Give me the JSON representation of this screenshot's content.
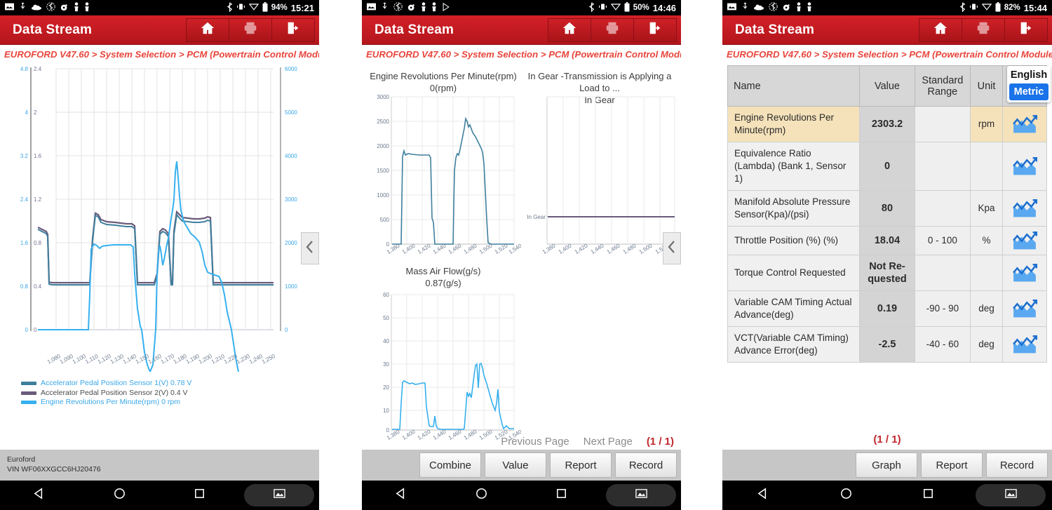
{
  "app": {
    "title": "Data Stream",
    "breadcrumb": "EUROFORD V47.60 > System Selection > PCM (Powertrain Control Module)"
  },
  "status_bars": [
    {
      "battery": "94%",
      "time": "15:21"
    },
    {
      "battery": "50%",
      "time": "14:46"
    },
    {
      "battery": "82%",
      "time": "15:44"
    }
  ],
  "titlebar_icons": [
    "home-icon",
    "print-icon",
    "exit-icon"
  ],
  "panel1": {
    "vehicle": "Euroford",
    "vin": "VIN WF06XXGCC6HJ20476",
    "legend": [
      {
        "label": "Accelerator Pedal Position Sensor 1(V) 0.78 V",
        "color": "#3f7f9e",
        "text_color": "#3aa7e8"
      },
      {
        "label": "Accelerator Pedal Position Sensor 2(V) 0.4 V",
        "color": "#6a5b7b",
        "text_color": "#4a4a4a"
      },
      {
        "label": "Engine Revolutions Per Minute(rpm) 0 rpm",
        "color": "#36b0ef",
        "text_color": "#3aa7e8"
      }
    ],
    "collapse_icon": "chevron-left-icon"
  },
  "panel2": {
    "charts": [
      {
        "title": "Engine Revolutions Per Minute(rpm)",
        "subtitle": "0(rpm)"
      },
      {
        "title": "In Gear -Transmission is Applying a Load to ...",
        "subtitle": "In Gear"
      },
      {
        "title": "Mass Air Flow(g/s)",
        "subtitle": "0.87(g/s)"
      }
    ],
    "pager": {
      "previous": "Previous Page",
      "next": "Next Page",
      "count": "(1 / 1)"
    },
    "buttons": [
      "Combine",
      "Value",
      "Report",
      "Record"
    ],
    "collapse_icon": "chevron-left-icon"
  },
  "panel3": {
    "columns": [
      "Name",
      "Value",
      "Standard Range",
      "Unit"
    ],
    "unit_toggle": {
      "english": "English",
      "metric": "Metric",
      "selected": "Metric",
      "accent": "#1a73e8"
    },
    "rows": [
      {
        "name": "Engine Revolutions Per Minute(rpm)",
        "value": "2303.2",
        "range": "",
        "unit": "rpm",
        "highlight": true,
        "graph_icon": "line-chart-icon"
      },
      {
        "name": "Equivalence Ratio (Lambda) (Bank 1, Sensor 1)",
        "value": "0",
        "range": "",
        "unit": "",
        "highlight": false,
        "graph_icon": "line-chart-icon"
      },
      {
        "name": "Manifold Absolute Pressure Sensor(Kpa)/(psi)",
        "value": "80",
        "range": "",
        "unit": "Kpa",
        "highlight": false,
        "graph_icon": "line-chart-icon"
      },
      {
        "name": "Throttle Position (%) (%)",
        "value": "18.04",
        "range": "0 - 100",
        "unit": "%",
        "highlight": false,
        "graph_icon": "line-chart-icon"
      },
      {
        "name": "Torque Control Requested",
        "value": "Not Re-quested",
        "range": "",
        "unit": "",
        "highlight": false,
        "graph_icon": "line-chart-icon"
      },
      {
        "name": "Variable CAM Timing Actual Advance(deg)",
        "value": "0.19",
        "range": "-90 - 90",
        "unit": "deg",
        "highlight": false,
        "graph_icon": "line-chart-icon"
      },
      {
        "name": "VCT(Variable CAM Timing) Advance Error(deg)",
        "value": "-2.5",
        "range": "-40 - 60",
        "unit": "deg",
        "highlight": false,
        "graph_icon": "line-chart-icon"
      }
    ],
    "page_indicator": "(1 / 1)",
    "buttons": [
      "Graph",
      "Report",
      "Record"
    ]
  },
  "chart_data": [
    {
      "type": "line",
      "id": "panel1-combined",
      "title": "",
      "xlabel": "",
      "grid": true,
      "legend": "bottom",
      "x_ticks": [
        "1,080",
        "1,090",
        "1,100",
        "1,110",
        "1,120",
        "1,130",
        "1,140",
        "1,150",
        "1,160",
        "1,170",
        "1,180",
        "1,190",
        "1,200",
        "1,210",
        "1,220",
        "1,230",
        "1,240",
        "1,250"
      ],
      "axes": [
        {
          "name": "Accelerator Pedal Position Sensor 1(V)",
          "ticks": [
            "0",
            "0.8",
            "1.6",
            "2.4",
            "3.2",
            "4",
            "4.8"
          ],
          "ylim": [
            0,
            4.8
          ],
          "side": "left",
          "color": "#3aa7e8"
        },
        {
          "name": "Accelerator Pedal Position Sensor 2(V)",
          "ticks": [
            "0",
            "0.4",
            "0.8",
            "1.2",
            "1.6",
            "2",
            "2.4"
          ],
          "ylim": [
            0,
            2.4
          ],
          "side": "left",
          "color": "#7a6f95"
        },
        {
          "name": "Engine Revolutions Per Minute(rpm)",
          "ticks": [
            "0",
            "1000",
            "2000",
            "3000",
            "4000",
            "5000",
            "6000"
          ],
          "ylim": [
            0,
            6000
          ],
          "side": "right",
          "color": "#3aa7e8"
        }
      ],
      "series": [
        {
          "name": "Accelerator Pedal Position Sensor 1(V)",
          "color": "#3f7f9e",
          "current": "0.78 V",
          "values": [
            1.92,
            1.9,
            1.88,
            0.88,
            0.88,
            0.88,
            0.88,
            0.88,
            0.88,
            2.62,
            2.4,
            2.38,
            2.36,
            2.34,
            2.34,
            2.32,
            0.88,
            0.88,
            0.88,
            1.88,
            1.92,
            0.88,
            2.52,
            2.4,
            2.38,
            2.36,
            2.38,
            2.4,
            0.88,
            0.88,
            0.88,
            0.88,
            0.88,
            0.88,
            0.88,
            0.88,
            0.88,
            0.88,
            0.88,
            0.88,
            0.88,
            0.88,
            0.88
          ]
        },
        {
          "name": "Accelerator Pedal Position Sensor 2(V)",
          "color": "#6a5b7b",
          "current": "0.4 V",
          "values": [
            1.94,
            1.92,
            1.9,
            0.88,
            0.88,
            0.88,
            0.88,
            0.88,
            0.88,
            2.64,
            2.44,
            2.42,
            2.4,
            2.38,
            2.38,
            2.36,
            0.88,
            0.88,
            0.88,
            1.92,
            1.96,
            0.88,
            2.54,
            2.46,
            2.44,
            2.42,
            2.44,
            2.46,
            0.88,
            0.88,
            0.88,
            0.88,
            0.88,
            0.88,
            0.88,
            0.88,
            0.88,
            0.88,
            0.88,
            0.88,
            0.88,
            0.88,
            0.88
          ]
        },
        {
          "name": "Engine Revolutions Per Minute(rpm)",
          "color": "#36b0ef",
          "current": "0 rpm",
          "values": [
            0,
            0,
            0,
            0,
            0,
            0,
            0,
            0,
            900,
            1780,
            1820,
            1830,
            1830,
            1830,
            1830,
            1400,
            700,
            180,
            0,
            1000,
            1850,
            1500,
            1790,
            2400,
            3100,
            2600,
            2350,
            2300,
            2080,
            1180,
            1100,
            1050,
            960,
            500,
            100,
            0,
            0,
            0,
            0,
            0,
            0,
            0,
            0
          ]
        }
      ]
    },
    {
      "type": "line",
      "id": "panel2-rpm",
      "title": "Engine Revolutions Per Minute(rpm)",
      "subtitle": "0(rpm)",
      "ylim": [
        0,
        3000
      ],
      "y_ticks": [
        "0",
        "500",
        "1000",
        "1500",
        "2000",
        "2500",
        "3000"
      ],
      "x_ticks": [
        "1,380",
        "1,400",
        "1,420",
        "1,440",
        "1,460",
        "1,480",
        "1,500",
        "1,520",
        "1,540"
      ],
      "color": "#3f7f9e",
      "values": [
        0,
        0,
        0,
        0,
        1850,
        1800,
        1790,
        1790,
        1780,
        1780,
        1770,
        1760,
        600,
        520,
        0,
        0,
        0,
        0,
        1900,
        2050,
        2300,
        2530,
        2450,
        2350,
        2150,
        1990,
        700,
        480,
        0,
        0,
        0,
        0
      ]
    },
    {
      "type": "line",
      "id": "panel2-ingear",
      "title": "In Gear -Transmission is Applying a Load to ...",
      "subtitle": "In Gear",
      "y_ticks": [
        "In Gear"
      ],
      "x_ticks": [
        "1,380",
        "1,400",
        "1,420",
        "1,440",
        "1,460",
        "1,480",
        "1,500",
        "1,520",
        "1,540"
      ],
      "color": "#6a5b7b",
      "values": [
        1,
        1,
        1,
        1,
        1,
        1,
        1,
        1,
        1,
        1,
        1,
        1,
        1,
        1,
        1,
        1
      ]
    },
    {
      "type": "line",
      "id": "panel2-maf",
      "title": "Mass Air Flow(g/s)",
      "subtitle": "0.87(g/s)",
      "ylim": [
        0,
        60
      ],
      "y_ticks": [
        "0",
        "10",
        "20",
        "30",
        "40",
        "50",
        "60"
      ],
      "x_ticks": [
        "1,380",
        "1,400",
        "1,420",
        "1,440",
        "1,460",
        "1,480",
        "1,500",
        "1,520",
        "1,540"
      ],
      "color": "#36b0ef",
      "values": [
        0,
        0,
        0,
        0,
        21,
        20,
        19.5,
        19.4,
        19.5,
        19.3,
        19.4,
        1,
        1,
        6.3,
        0.5,
        0.4,
        0.4,
        0.4,
        0.4,
        0.4,
        0.5,
        18,
        14,
        15,
        32,
        12,
        32,
        28,
        22,
        10,
        3,
        10,
        2,
        1,
        0.9,
        0.87
      ]
    }
  ]
}
